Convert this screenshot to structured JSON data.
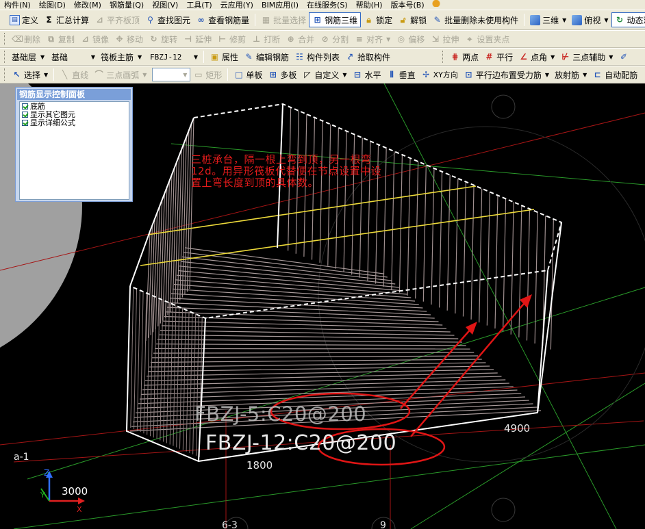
{
  "menu": {
    "items": [
      "构件(N)",
      "绘图(D)",
      "修改(M)",
      "钢筋量(Q)",
      "视图(V)",
      "工具(T)",
      "云应用(Y)",
      "BIM应用(I)",
      "在线服务(S)",
      "帮助(H)",
      "版本号(B)"
    ]
  },
  "toolbar1": {
    "define": "定义",
    "summary": "汇总计算",
    "flat_top": "平齐板顶",
    "find_element": "查找图元",
    "view_rebar": "查看钢筋量",
    "batch_select": "批量选择",
    "rebar_3d": "钢筋三维",
    "lock": "锁定",
    "unlock": "解锁",
    "batch_delete": "批量删除未使用构件",
    "three_d": "三维",
    "top_view": "俯视",
    "dynamic": "动态观"
  },
  "toolbar2": {
    "delete": "删除",
    "copy": "复制",
    "mirror": "镜像",
    "move": "移动",
    "rotate": "旋转",
    "extend": "延伸",
    "trim": "修剪",
    "break": "打断",
    "merge": "合并",
    "split": "分割",
    "align": "对齐",
    "offset": "偏移",
    "stretch": "拉伸",
    "set_grip": "设置夹点"
  },
  "toolbar3": {
    "layer": "基础层",
    "category": "基础",
    "type": "筏板主筋",
    "element": "FBZJ-12",
    "properties": "属性",
    "edit_rebar": "编辑钢筋",
    "element_list": "构件列表",
    "pick_element": "拾取构件",
    "two_points": "两点",
    "parallel": "平行",
    "point_angle": "点角",
    "three_point_aux": "三点辅助"
  },
  "toolbar4": {
    "select": "选择",
    "line": "直线",
    "arc": "三点画弧",
    "combo_blank": "",
    "rect": "矩形",
    "single_slab": "单板",
    "multi_slab": "多板",
    "custom": "自定义",
    "horizontal": "水平",
    "vertical": "垂直",
    "xy_dir": "XY方向",
    "parallel_edge": "平行边布置受力筋",
    "radial": "放射筋",
    "auto_config": "自动配筋"
  },
  "panel": {
    "title": "钢筋显示控制面板",
    "items": [
      {
        "label": "底筋",
        "checked": true
      },
      {
        "label": "显示其它图元",
        "checked": true
      },
      {
        "label": "显示详细公式",
        "checked": true
      }
    ]
  },
  "annotation": {
    "note": "三桩承台，隔一根上弯到顶，另一根弯12d。用异形筏板代替便在节点设置中设置上弯长度到顶的具体数。"
  },
  "labels": {
    "rebar_1": "FBZJ-5:C20@200",
    "rebar_2": "FBZJ-12:C20@200",
    "dim_left": "1800",
    "dim_right": "4900",
    "axis_a": "a-1",
    "axis_63": "6-3",
    "axis_9": "9",
    "coord_value": "3000",
    "coord_x": "X",
    "coord_y": "Y",
    "coord_z": "Z"
  },
  "colors": {
    "chrome_bg": "#ece9d8",
    "annotation_red": "#e41b1b",
    "highlight_yellow": "#f0e040",
    "grid_green": "#2aa02a",
    "grid_red": "#b01818"
  }
}
